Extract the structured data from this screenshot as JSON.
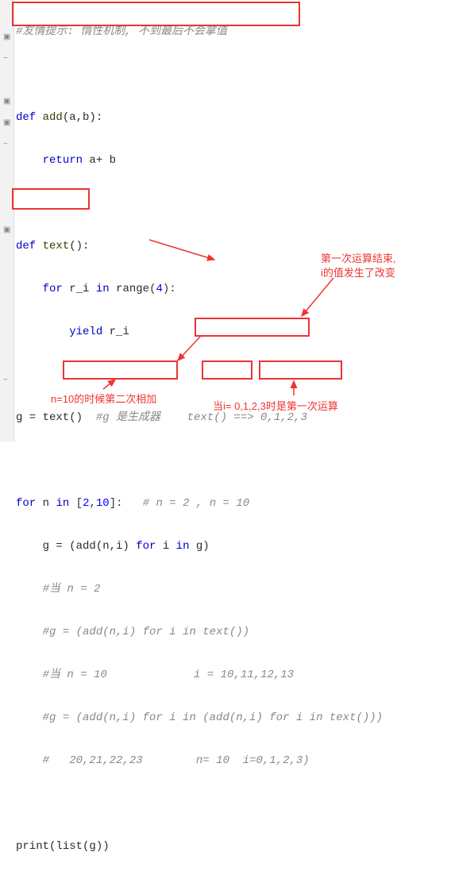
{
  "lines": {
    "l1": "#友情提示: 惰性机制, 不到最后不会拿值",
    "l2_def": "def",
    "l2_fn": " add",
    "l2_rest": "(a,b):",
    "l3_kw": "return",
    "l3_rest": " a+ b",
    "l4_def": "def",
    "l4_fn": " text",
    "l4_rest": "():",
    "l5_kw": "for",
    "l5_var": " r_i ",
    "l5_in": "in",
    "l5_rng": " range",
    "l5_p": "(",
    "l5_n": "4",
    "l5_q": "):",
    "l6_kw": "yield",
    "l6_rest": " r_i",
    "l7_a": "g = text()",
    "l7_c": "#g 是生成器    text() ==> 0,1,2,3",
    "l8_for": "for",
    "l8_a": " n ",
    "l8_in": "in",
    "l8_b": " [",
    "l8_n1": "2",
    "l8_c1": ",",
    "l8_n2": "10",
    "l8_d": "]:   ",
    "l8_cm": "# n = 2 , n = 10",
    "l9_a": "g = (add(n,i) ",
    "l9_for": "for",
    "l9_b": " i ",
    "l9_in": "in",
    "l9_c": " g)",
    "l10": "#当 n = 2",
    "l11": "#g = (add(n,i) for i in text())",
    "l12a": "#当 n = 10             ",
    "l12b": "i = 10,11,12,13",
    "l13": "#g = (add(n,i) for i in (add(n,i) for i in text()))",
    "l14a": "#   ",
    "l14b": "20,21,22,23",
    "l14c": "        ",
    "l14d": "n= 10",
    "l14e": "  ",
    "l14f": "i=0,1,2,3)",
    "l15_p": "print",
    "l15_r": "(list(g))"
  },
  "ann": {
    "a1a": "第一次运算结束,",
    "a1b": "i的值发生了改变",
    "a2": "n=10的时候第二次相加",
    "a3": "当i= 0,1,2,3时是第一次运算"
  }
}
